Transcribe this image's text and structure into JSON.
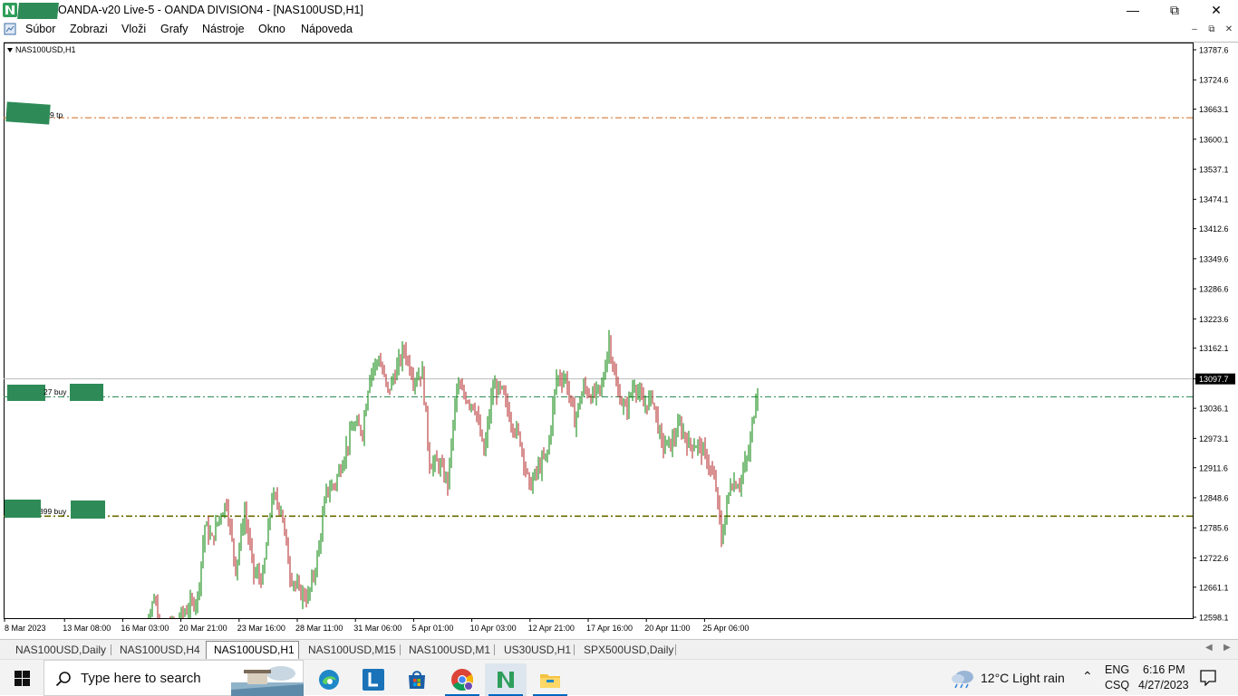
{
  "window": {
    "title": "OANDA-v20 Live-5 - OANDA DIVISION4 - [NAS100USD,H1]"
  },
  "menu": {
    "items": [
      "Súbor",
      "Zobrazi",
      "Vloži",
      "Grafy",
      "Nástroje",
      "Okno",
      "Nápoveda"
    ]
  },
  "chart": {
    "symbol_label": "NAS100USD,H1",
    "current_price": "13097.7",
    "price_ticks": [
      "13787.6",
      "13724.6",
      "13663.1",
      "13600.1",
      "13537.1",
      "13474.1",
      "13412.6",
      "13349.6",
      "13286.6",
      "13223.6",
      "13162.1",
      "13097.7",
      "13036.1",
      "12973.1",
      "12911.6",
      "12848.6",
      "12785.6",
      "12722.6",
      "12661.1",
      "12598.1"
    ],
    "time_ticks": [
      "8 Mar 2023",
      "13 Mar 08:00",
      "16 Mar 03:00",
      "20 Mar 21:00",
      "23 Mar 16:00",
      "28 Mar 11:00",
      "31 Mar 06:00",
      "5 Apr 01:00",
      "10 Apr 03:00",
      "12 Apr 21:00",
      "17 Apr 16:00",
      "20 Apr 11:00",
      "25 Apr 06:00"
    ],
    "level_lines": [
      {
        "label": "9 tp",
        "price": 13645,
        "color": "#d2691e"
      },
      {
        "label": "27 buy",
        "price": 13060,
        "color": "#2e8b57"
      },
      {
        "label": "399 buy",
        "price": 12810,
        "color": "#6b6b00"
      }
    ],
    "colors": {
      "bull": "#008000",
      "bear": "#b22222",
      "grid": "#bcbcbc"
    }
  },
  "tabs": {
    "items": [
      "NAS100USD,Daily",
      "NAS100USD,H4",
      "NAS100USD,H1",
      "NAS100USD,M15",
      "NAS100USD,M1",
      "US30USD,H1",
      "SPX500USD,Daily"
    ],
    "active": "NAS100USD,H1"
  },
  "taskbar": {
    "search_placeholder": "Type here to search",
    "weather": "12°C  Light rain",
    "lang_top": "ENG",
    "lang_bottom": "CSQ",
    "time": "6:16 PM",
    "date": "4/27/2023"
  }
}
